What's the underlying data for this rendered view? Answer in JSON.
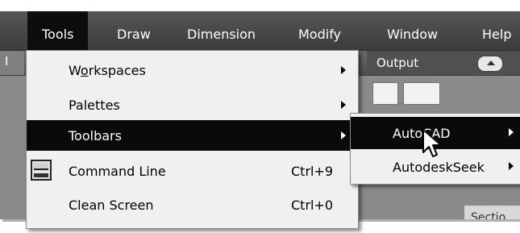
{
  "menubar": {
    "items": [
      {
        "label": "Tools"
      },
      {
        "label": "Draw"
      },
      {
        "label": "Dimension"
      },
      {
        "label": "Modify"
      },
      {
        "label": "Window"
      },
      {
        "label": "Help"
      }
    ]
  },
  "ribbon": {
    "left_tab": "I",
    "output_tab": "Output",
    "section_label": "Sectio"
  },
  "tools_menu": {
    "items": [
      {
        "label_pre": "W",
        "label_u": "o",
        "label_post": "rkspaces",
        "shortcut": "",
        "submenu": true
      },
      {
        "label": "Palettes",
        "shortcut": "",
        "submenu": true
      },
      {
        "label": "Toolbars",
        "shortcut": "",
        "submenu": true,
        "highlighted": true
      },
      {
        "label": "Command Line",
        "shortcut": "Ctrl+9",
        "icon": "command-line-icon"
      },
      {
        "label": "Clean Screen",
        "shortcut": "Ctrl+0"
      }
    ]
  },
  "toolbars_submenu": {
    "items": [
      {
        "label": "AutoCAD",
        "submenu": true,
        "highlighted": true
      },
      {
        "label": "AutodeskSeek",
        "submenu": true
      }
    ]
  },
  "colors": {
    "menubar_bg": "#4a4a4a",
    "highlight": "#0a0a0a",
    "menu_bg": "#f0f0f0"
  }
}
